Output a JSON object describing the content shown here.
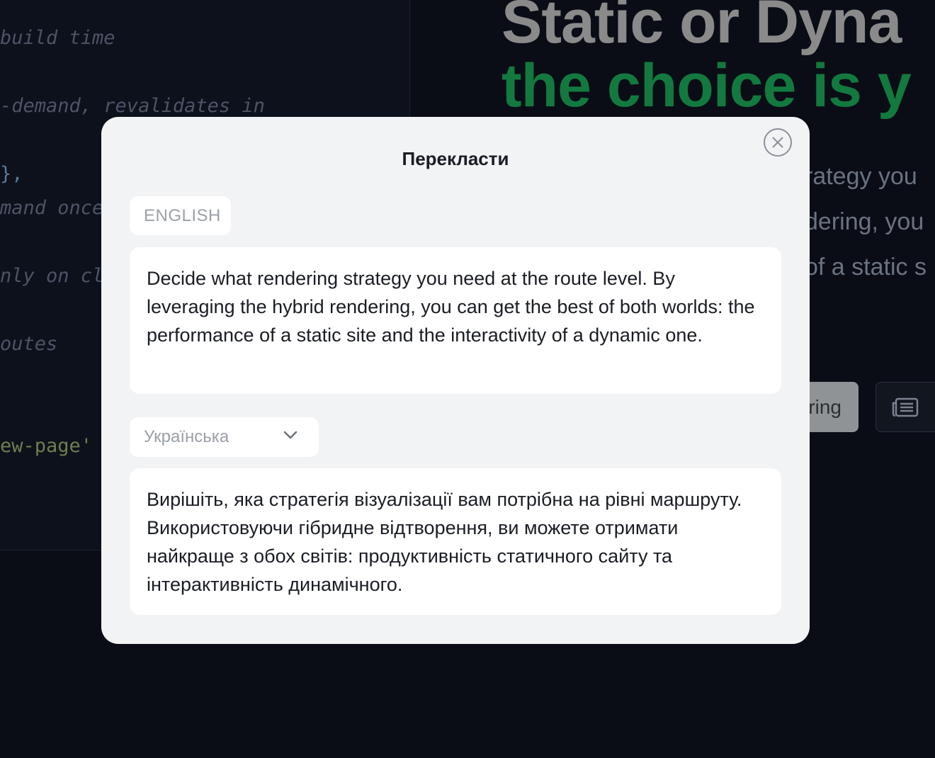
{
  "background": {
    "code_lines": [
      {
        "text": "build time",
        "kind": "comment"
      },
      {
        "text": "-demand, revalidates in",
        "kind": "comment"
      },
      {
        "text": "},",
        "kind": "punct"
      },
      {
        "text": "mand once",
        "kind": "comment"
      },
      {
        "text": "nly on cl",
        "kind": "comment"
      },
      {
        "text": "outes",
        "kind": "comment"
      },
      {
        "text": "ew-page'",
        "kind": "string"
      }
    ],
    "hero": {
      "title_line_1": "Static or Dyna",
      "title_line_2": "the choice is y",
      "desc_lines": [
        "rategy you",
        "dering, you",
        "of a static s"
      ],
      "primary_button_label": "ring",
      "secondary_button_icon": "newspaper-icon"
    }
  },
  "modal": {
    "title": "Перекласти",
    "close_icon": "close-icon",
    "source": {
      "language": "ENGLISH",
      "text": "Decide what rendering strategy you need at the route level. By leveraging the hybrid rendering, you can get the best of both worlds: the performance of a static site and the interactivity of a dynamic one."
    },
    "target": {
      "language_selected": "Українська",
      "dropdown_icon": "chevron-down-icon",
      "text": "Вирішіть, яка стратегія візуалізації вам потрібна на рівні маршруту. Використовуючи гібридне відтворення, ви можете отримати найкраще з обох світів: продуктивність статичного сайту та інтерактивність динамічного."
    }
  },
  "colors": {
    "page_background": "#0a0d16",
    "modal_background": "#f2f3f5",
    "card_background": "#ffffff",
    "hero_accent_green": "#13793f",
    "muted_text": "#9ba0a8"
  }
}
